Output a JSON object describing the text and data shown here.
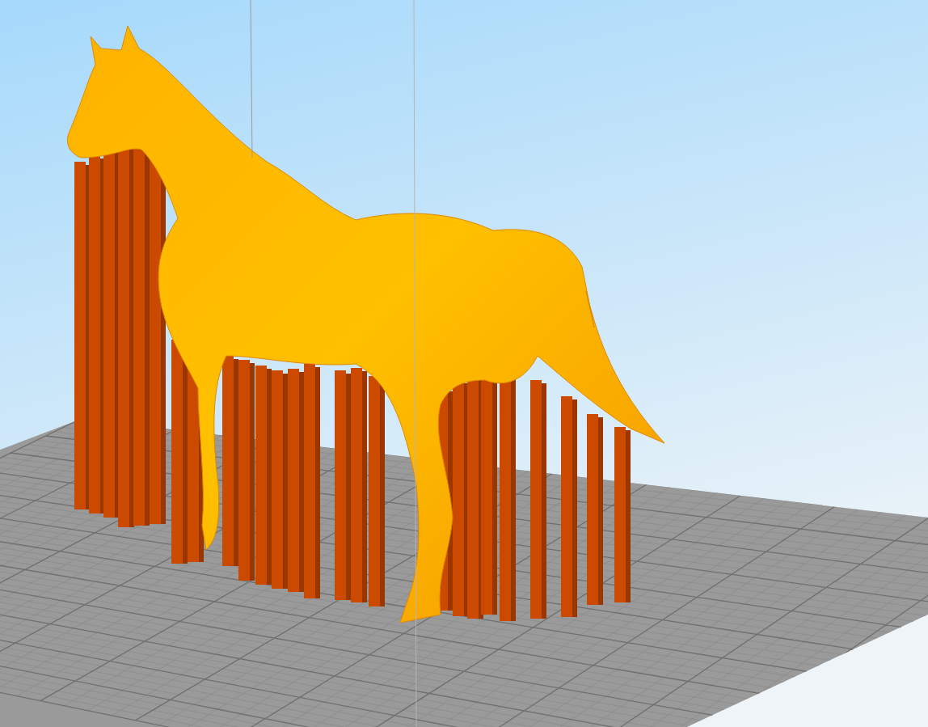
{
  "scene": {
    "kind": "print-preview"
  }
}
